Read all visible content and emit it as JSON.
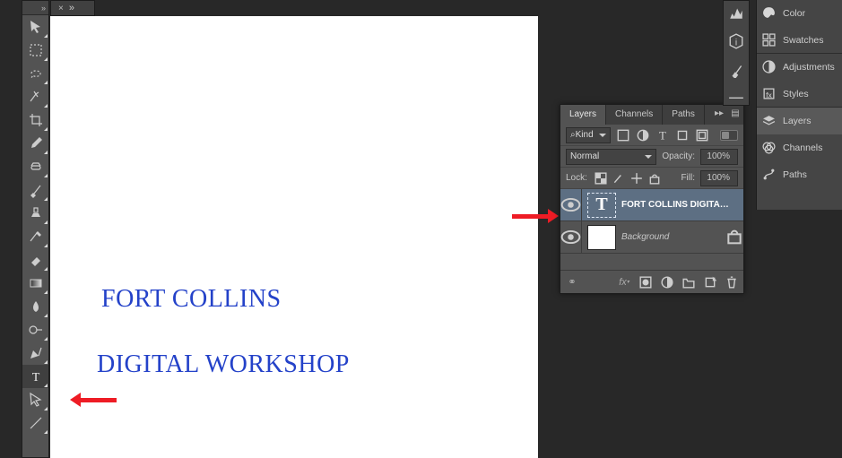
{
  "doc": {
    "tab_close": "×",
    "tab_expand": "»",
    "text_line1": "Fort Collins",
    "text_line2": "Digital Workshop"
  },
  "tools": {
    "expand": "»",
    "items": [
      "move-tool",
      "marquee-tool",
      "lasso-tool",
      "quick-select-tool",
      "crop-tool",
      "eyedropper-tool",
      "healing-brush-tool",
      "brush-tool",
      "clone-stamp-tool",
      "history-brush-tool",
      "eraser-tool",
      "gradient-tool",
      "blur-tool",
      "dodge-tool",
      "pen-tool",
      "type-tool",
      "path-select-tool",
      "line-tool"
    ],
    "selected": "type-tool"
  },
  "layers_panel": {
    "tabs": {
      "layers": "Layers",
      "channels": "Channels",
      "paths": "Paths"
    },
    "filter_kind_label": "Kind",
    "filter_kind_glyph": "⌕",
    "blend_mode": "Normal",
    "opacity_label": "Opacity:",
    "opacity_value": "100%",
    "lock_label": "Lock:",
    "fill_label": "Fill:",
    "fill_value": "100%",
    "layers": [
      {
        "name": "FORT COLLINS   DIGITA…",
        "type": "text",
        "visible": true,
        "selected": true
      },
      {
        "name": "Background",
        "type": "bg",
        "visible": true,
        "locked": true
      }
    ]
  },
  "panel_tabs": {
    "items": [
      {
        "name": "color",
        "label": "Color"
      },
      {
        "name": "swatches",
        "label": "Swatches"
      },
      {
        "name": "adjustments",
        "label": "Adjustments"
      },
      {
        "name": "styles",
        "label": "Styles"
      },
      {
        "name": "layers",
        "label": "Layers",
        "active": true
      },
      {
        "name": "channels",
        "label": "Channels"
      },
      {
        "name": "paths",
        "label": "Paths"
      }
    ]
  }
}
